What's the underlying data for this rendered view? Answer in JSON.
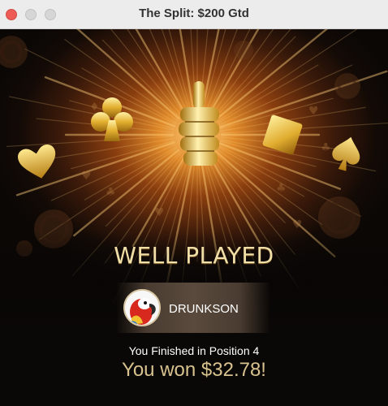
{
  "window": {
    "title": "The Split: $200 Gtd"
  },
  "result": {
    "headline": "WELL PLAYED",
    "player_name": "DRUNKSON",
    "finished_text": "You Finished in Position 4",
    "won_text": "You won $32.78!"
  },
  "icons": {
    "thumbs_up": "thumbs-up-icon",
    "club": "club-icon",
    "heart": "heart-icon",
    "diamond": "diamond-icon",
    "spade": "spade-icon",
    "chip": "poker-chip-icon",
    "avatar": "parrot-avatar"
  },
  "colors": {
    "gold": "#f1dfa8",
    "won_text": "#d8c28e",
    "close_button": "#ee5b55"
  }
}
